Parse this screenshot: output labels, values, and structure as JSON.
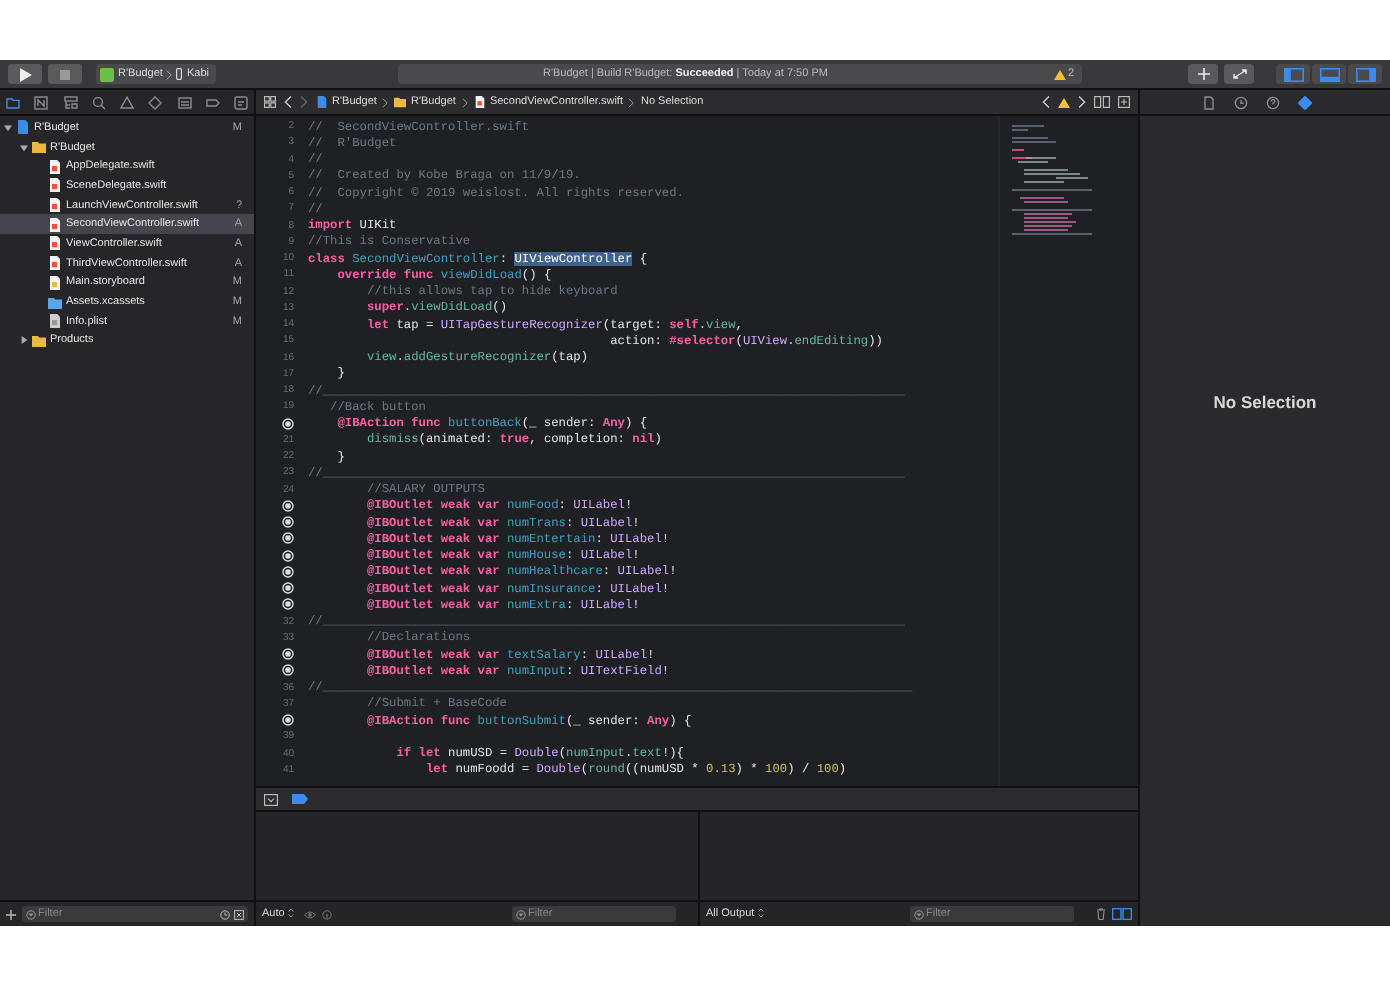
{
  "toolbar": {
    "scheme": {
      "project": "R'Budget",
      "device": "Kabi"
    },
    "activity": {
      "text": "R'Budget | Build R'Budget: **Succeeded** | Today at 7:50 PM",
      "warnings": "2"
    },
    "panels": [
      {
        "kind": "left",
        "on": true
      },
      {
        "kind": "bottom",
        "on": true
      },
      {
        "kind": "right",
        "on": true
      }
    ]
  },
  "navigator": {
    "tabs": [
      {
        "kind": "folder",
        "selected": true
      },
      {
        "kind": "source",
        "selected": false
      },
      {
        "kind": "hierarchy",
        "selected": false
      },
      {
        "kind": "search",
        "selected": false
      },
      {
        "kind": "warning",
        "selected": false
      },
      {
        "kind": "test",
        "selected": false
      },
      {
        "kind": "debug",
        "selected": false
      },
      {
        "kind": "breakpoint",
        "selected": false
      },
      {
        "kind": "report",
        "selected": false
      }
    ],
    "tree": [
      {
        "name": "R'Budget",
        "kind": "project",
        "status": "M",
        "expanded": true,
        "selected": false,
        "children": [
          {
            "name": "R'Budget",
            "kind": "folder",
            "expanded": true,
            "selected": false,
            "children": [
              {
                "name": "AppDelegate.swift",
                "kind": "swift",
                "selected": false
              },
              {
                "name": "SceneDelegate.swift",
                "kind": "swift",
                "selected": false
              },
              {
                "name": "LaunchViewController.swift",
                "kind": "swift",
                "status": "?",
                "selected": false
              },
              {
                "name": "SecondViewController.swift",
                "kind": "swift",
                "status": "A",
                "selected": true
              },
              {
                "name": "ViewController.swift",
                "kind": "swift",
                "status": "A",
                "selected": false
              },
              {
                "name": "ThirdViewController.swift",
                "kind": "swift",
                "status": "A",
                "selected": false
              },
              {
                "name": "Main.storyboard",
                "kind": "storyboard",
                "status": "M",
                "selected": false
              },
              {
                "name": "Assets.xcassets",
                "kind": "assets",
                "status": "M",
                "selected": false
              },
              {
                "name": "Info.plist",
                "kind": "plist",
                "status": "M",
                "selected": false
              }
            ]
          },
          {
            "name": "Products",
            "kind": "folder",
            "expanded": false,
            "selected": false
          }
        ]
      }
    ],
    "filter": {
      "placeholder": "Filter"
    }
  },
  "editor": {
    "path": [
      {
        "kind": "project",
        "label": "R'Budget"
      },
      {
        "kind": "folder",
        "label": "R'Budget"
      },
      {
        "kind": "swift",
        "label": "SecondViewController.swift"
      }
    ],
    "selection": "No Selection",
    "lines": [
      {
        "number": "2",
        "outlet": false,
        "tokens": [
          {
            "kind": "comment",
            "text": "//  SecondViewController.swift"
          }
        ]
      },
      {
        "number": "3",
        "outlet": false,
        "tokens": [
          {
            "kind": "comment",
            "text": "//  R'Budget"
          }
        ]
      },
      {
        "number": "4",
        "outlet": false,
        "tokens": [
          {
            "kind": "comment",
            "text": "//"
          }
        ]
      },
      {
        "number": "5",
        "outlet": false,
        "tokens": [
          {
            "kind": "comment",
            "text": "//  Created by Kobe Braga on 11/9/19."
          }
        ]
      },
      {
        "number": "6",
        "outlet": false,
        "tokens": [
          {
            "kind": "comment",
            "text": "//  Copyright © 2019 weislost. All rights reserved."
          }
        ]
      },
      {
        "number": "7",
        "outlet": false,
        "tokens": [
          {
            "kind": "comment",
            "text": "//"
          }
        ]
      },
      {
        "number": "8",
        "outlet": false,
        "tokens": [
          {
            "kind": "keyword",
            "text": "import"
          },
          {
            "kind": "plain",
            "text": " UIKit"
          }
        ]
      },
      {
        "number": "9",
        "outlet": false,
        "tokens": [
          {
            "kind": "comment",
            "text": "//This is Conservative"
          }
        ]
      },
      {
        "number": "10",
        "outlet": false,
        "tokens": [
          {
            "kind": "keyword",
            "text": "class "
          },
          {
            "kind": "declaration",
            "text": "SecondViewController"
          },
          {
            "kind": "plain",
            "text": ": "
          },
          {
            "kind": "selection",
            "text": "UIViewController"
          },
          {
            "kind": "plain",
            "text": " {"
          }
        ]
      },
      {
        "number": "11",
        "outlet": false,
        "tokens": [
          {
            "kind": "keyword",
            "text": "    override func "
          },
          {
            "kind": "declaration",
            "text": "viewDidLoad"
          },
          {
            "kind": "plain",
            "text": "() {"
          }
        ]
      },
      {
        "number": "12",
        "outlet": false,
        "tokens": [
          {
            "kind": "comment",
            "text": "        //this allows tap to hide keyboard"
          }
        ]
      },
      {
        "number": "13",
        "outlet": false,
        "tokens": [
          {
            "kind": "keyword",
            "text": "        super"
          },
          {
            "kind": "plain",
            "text": "."
          },
          {
            "kind": "member",
            "text": "viewDidLoad"
          },
          {
            "kind": "plain",
            "text": "()"
          }
        ]
      },
      {
        "number": "14",
        "outlet": false,
        "tokens": [
          {
            "kind": "keyword",
            "text": "        let"
          },
          {
            "kind": "plain",
            "text": " tap = "
          },
          {
            "kind": "type",
            "text": "UITapGestureRecognizer"
          },
          {
            "kind": "plain",
            "text": "(target: "
          },
          {
            "kind": "keyword",
            "text": "self"
          },
          {
            "kind": "plain",
            "text": "."
          },
          {
            "kind": "member",
            "text": "view"
          },
          {
            "kind": "plain",
            "text": ","
          }
        ]
      },
      {
        "number": "15",
        "outlet": false,
        "tokens": [
          {
            "kind": "plain",
            "text": "                                         action: "
          },
          {
            "kind": "keyword",
            "text": "#selector"
          },
          {
            "kind": "plain",
            "text": "("
          },
          {
            "kind": "type",
            "text": "UIView"
          },
          {
            "kind": "plain",
            "text": "."
          },
          {
            "kind": "member",
            "text": "endEditing"
          },
          {
            "kind": "plain",
            "text": "))"
          }
        ]
      },
      {
        "number": "16",
        "outlet": false,
        "tokens": [
          {
            "kind": "member",
            "text": "        view"
          },
          {
            "kind": "plain",
            "text": "."
          },
          {
            "kind": "member",
            "text": "addGestureRecognizer"
          },
          {
            "kind": "plain",
            "text": "(tap)"
          }
        ]
      },
      {
        "number": "17",
        "outlet": false,
        "tokens": [
          {
            "kind": "plain",
            "text": "    }"
          }
        ]
      },
      {
        "number": "18",
        "outlet": false,
        "tokens": [
          {
            "kind": "comment",
            "text": "//_______________________________________________________________________________"
          }
        ]
      },
      {
        "number": "19",
        "outlet": false,
        "tokens": [
          {
            "kind": "comment",
            "text": "   //Back button"
          }
        ]
      },
      {
        "outlet": true,
        "tokens": [
          {
            "kind": "keyword",
            "text": "    @IBAction func "
          },
          {
            "kind": "declaration",
            "text": "buttonBack"
          },
          {
            "kind": "plain",
            "text": "(_ sender: "
          },
          {
            "kind": "keyword",
            "text": "Any"
          },
          {
            "kind": "plain",
            "text": ") {"
          }
        ]
      },
      {
        "number": "21",
        "outlet": false,
        "tokens": [
          {
            "kind": "member",
            "text": "        dismiss"
          },
          {
            "kind": "plain",
            "text": "(animated: "
          },
          {
            "kind": "keyword",
            "text": "true"
          },
          {
            "kind": "plain",
            "text": ", completion: "
          },
          {
            "kind": "keyword",
            "text": "nil"
          },
          {
            "kind": "plain",
            "text": ")"
          }
        ]
      },
      {
        "number": "22",
        "outlet": false,
        "tokens": [
          {
            "kind": "plain",
            "text": "    }"
          }
        ]
      },
      {
        "number": "23",
        "outlet": false,
        "tokens": [
          {
            "kind": "comment",
            "text": "//_______________________________________________________________________________"
          }
        ]
      },
      {
        "number": "24",
        "outlet": false,
        "tokens": [
          {
            "kind": "comment",
            "text": "        //SALARY OUTPUTS"
          }
        ]
      },
      {
        "outlet": true,
        "tokens": [
          {
            "kind": "keyword",
            "text": "        @IBOutlet weak var "
          },
          {
            "kind": "declaration",
            "text": "numFood"
          },
          {
            "kind": "plain",
            "text": ": "
          },
          {
            "kind": "type",
            "text": "UILabel"
          },
          {
            "kind": "plain",
            "text": "!"
          }
        ]
      },
      {
        "outlet": true,
        "tokens": [
          {
            "kind": "keyword",
            "text": "        @IBOutlet weak var "
          },
          {
            "kind": "declaration",
            "text": "numTrans"
          },
          {
            "kind": "plain",
            "text": ": "
          },
          {
            "kind": "type",
            "text": "UILabel"
          },
          {
            "kind": "plain",
            "text": "!"
          }
        ]
      },
      {
        "outlet": true,
        "tokens": [
          {
            "kind": "keyword",
            "text": "        @IBOutlet weak var "
          },
          {
            "kind": "declaration",
            "text": "numEntertain"
          },
          {
            "kind": "plain",
            "text": ": "
          },
          {
            "kind": "type",
            "text": "UILabel"
          },
          {
            "kind": "plain",
            "text": "!"
          }
        ]
      },
      {
        "outlet": true,
        "tokens": [
          {
            "kind": "keyword",
            "text": "        @IBOutlet weak var "
          },
          {
            "kind": "declaration",
            "text": "numHouse"
          },
          {
            "kind": "plain",
            "text": ": "
          },
          {
            "kind": "type",
            "text": "UILabel"
          },
          {
            "kind": "plain",
            "text": "!"
          }
        ]
      },
      {
        "outlet": true,
        "tokens": [
          {
            "kind": "keyword",
            "text": "        @IBOutlet weak var "
          },
          {
            "kind": "declaration",
            "text": "numHealthcare"
          },
          {
            "kind": "plain",
            "text": ": "
          },
          {
            "kind": "type",
            "text": "UILabel"
          },
          {
            "kind": "plain",
            "text": "!"
          }
        ]
      },
      {
        "outlet": true,
        "tokens": [
          {
            "kind": "keyword",
            "text": "        @IBOutlet weak var "
          },
          {
            "kind": "declaration",
            "text": "numInsurance"
          },
          {
            "kind": "plain",
            "text": ": "
          },
          {
            "kind": "type",
            "text": "UILabel"
          },
          {
            "kind": "plain",
            "text": "!"
          }
        ]
      },
      {
        "outlet": true,
        "tokens": [
          {
            "kind": "keyword",
            "text": "        @IBOutlet weak var "
          },
          {
            "kind": "declaration",
            "text": "numExtra"
          },
          {
            "kind": "plain",
            "text": ": "
          },
          {
            "kind": "type",
            "text": "UILabel"
          },
          {
            "kind": "plain",
            "text": "!"
          }
        ]
      },
      {
        "number": "32",
        "outlet": false,
        "tokens": [
          {
            "kind": "comment",
            "text": "//_______________________________________________________________________________"
          }
        ]
      },
      {
        "number": "33",
        "outlet": false,
        "tokens": [
          {
            "kind": "comment",
            "text": "        //Declarations"
          }
        ]
      },
      {
        "outlet": true,
        "tokens": [
          {
            "kind": "keyword",
            "text": "        @IBOutlet weak var "
          },
          {
            "kind": "declaration",
            "text": "textSalary"
          },
          {
            "kind": "plain",
            "text": ": "
          },
          {
            "kind": "type",
            "text": "UILabel"
          },
          {
            "kind": "plain",
            "text": "!"
          }
        ]
      },
      {
        "outlet": true,
        "tokens": [
          {
            "kind": "keyword",
            "text": "        @IBOutlet weak var "
          },
          {
            "kind": "declaration",
            "text": "numInput"
          },
          {
            "kind": "plain",
            "text": ": "
          },
          {
            "kind": "type",
            "text": "UITextField"
          },
          {
            "kind": "plain",
            "text": "!"
          }
        ]
      },
      {
        "number": "36",
        "outlet": false,
        "tokens": [
          {
            "kind": "comment",
            "text": "//________________________________________________________________________________"
          }
        ]
      },
      {
        "number": "37",
        "outlet": false,
        "tokens": [
          {
            "kind": "comment",
            "text": "        //Submit + BaseCode"
          }
        ]
      },
      {
        "outlet": true,
        "tokens": [
          {
            "kind": "keyword",
            "text": "        @IBAction func "
          },
          {
            "kind": "declaration",
            "text": "buttonSubmit"
          },
          {
            "kind": "plain",
            "text": "(_ sender: "
          },
          {
            "kind": "keyword",
            "text": "Any"
          },
          {
            "kind": "plain",
            "text": ") {"
          }
        ]
      },
      {
        "number": "39",
        "outlet": false
      },
      {
        "number": "40",
        "outlet": false,
        "tokens": [
          {
            "kind": "keyword",
            "text": "            if let"
          },
          {
            "kind": "plain",
            "text": " numUSD = "
          },
          {
            "kind": "type",
            "text": "Double"
          },
          {
            "kind": "plain",
            "text": "("
          },
          {
            "kind": "member",
            "text": "numInput"
          },
          {
            "kind": "plain",
            "text": "."
          },
          {
            "kind": "member",
            "text": "text"
          },
          {
            "kind": "plain",
            "text": "!){"
          }
        ]
      },
      {
        "number": "41",
        "outlet": false,
        "tokens": [
          {
            "kind": "keyword",
            "text": "                let"
          },
          {
            "kind": "plain",
            "text": " numFoodd = "
          },
          {
            "kind": "type",
            "text": "Double"
          },
          {
            "kind": "plain",
            "text": "("
          },
          {
            "kind": "member",
            "text": "round"
          },
          {
            "kind": "plain",
            "text": "((numUSD * "
          },
          {
            "kind": "number",
            "text": "0.13"
          },
          {
            "kind": "plain",
            "text": ") * "
          },
          {
            "kind": "number",
            "text": "100"
          },
          {
            "kind": "plain",
            "text": ") / "
          },
          {
            "kind": "number",
            "text": "100"
          },
          {
            "kind": "plain",
            "text": ")"
          }
        ]
      }
    ]
  },
  "debug": {
    "breakpoints_active": true,
    "scope": "Auto",
    "variables_filter": {
      "placeholder": "Filter"
    },
    "output": "All Output",
    "console_filter": {
      "placeholder": "Filter"
    }
  },
  "inspector": {
    "tabs": [
      {
        "kind": "file",
        "selected": false
      },
      {
        "kind": "history",
        "selected": false
      },
      {
        "kind": "help",
        "selected": false
      },
      {
        "kind": "attributes",
        "selected": true
      }
    ],
    "message": "No Selection"
  }
}
